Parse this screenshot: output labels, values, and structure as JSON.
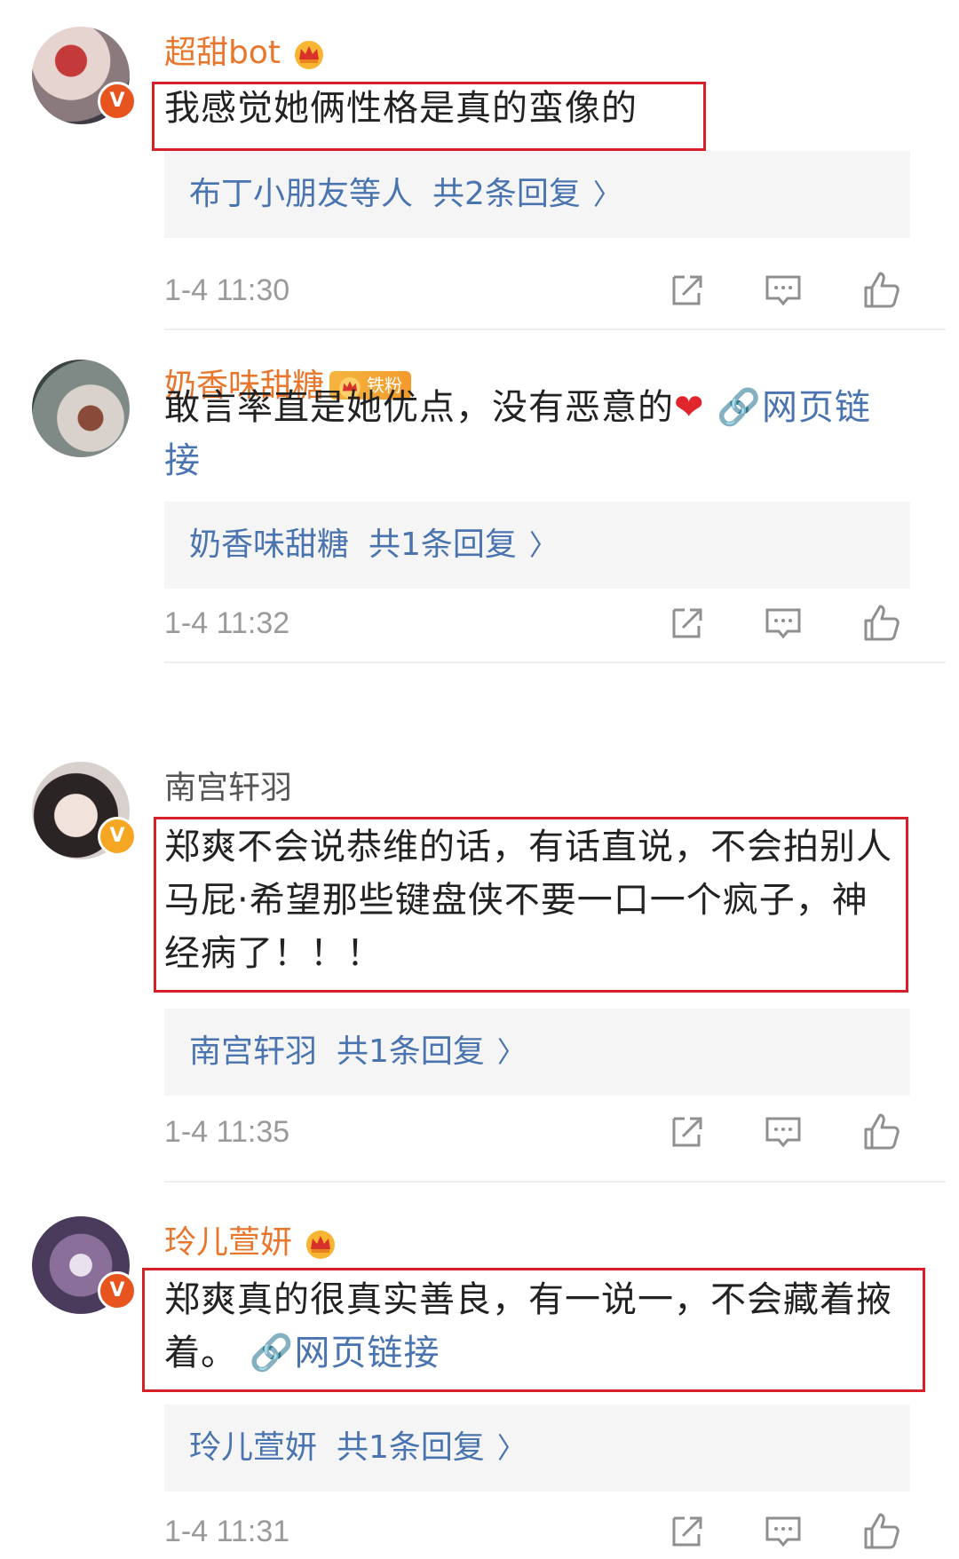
{
  "comments": [
    {
      "username": "超甜bot",
      "fan_badge": "",
      "text_parts": [
        "我感觉她俩性格是真的蛮像的"
      ],
      "link_text": "",
      "reply_from": "布丁小朋友等人",
      "reply_count": "共2条回复",
      "time": "1-4 11:30"
    },
    {
      "username": "奶香味甜糖",
      "fan_badge": "铁粉",
      "text_parts": [
        "敢言率直是她优点，没有恶意的"
      ],
      "link_text": "网页链接",
      "reply_from": "奶香味甜糖",
      "reply_count": "共1条回复",
      "time": "1-4 11:32"
    },
    {
      "username": "南宫轩羽",
      "fan_badge": "",
      "text_parts": [
        "郑爽不会说恭维的话，有话直说，不会拍别人马屁·希望那些键盘侠不要一口一个疯子，神经病了！！！"
      ],
      "link_text": "",
      "reply_from": "南宫轩羽",
      "reply_count": "共1条回复",
      "time": "1-4 11:35"
    },
    {
      "username": "玲儿萱妍",
      "fan_badge": "",
      "text_parts": [
        "郑爽真的很真实善良，有一说一，不会藏着掖着。"
      ],
      "link_text": "网页链接",
      "reply_from": "玲儿萱妍",
      "reply_count": "共1条回复",
      "time": "1-4 11:31"
    }
  ],
  "icons": {
    "share": "share-icon",
    "comment": "comment-icon",
    "like": "like-icon",
    "link": "link-icon",
    "heart": "heart-emoji",
    "crown": "crown-icon",
    "verified": "verified-v-icon",
    "chevron": "chevron-right-icon"
  },
  "colors": {
    "vip_name": "#e8762d",
    "link": "#4a74b0",
    "highlight_box": "#d61f26",
    "verified_orange": "#f5a623",
    "verified_red": "#e8541e"
  }
}
